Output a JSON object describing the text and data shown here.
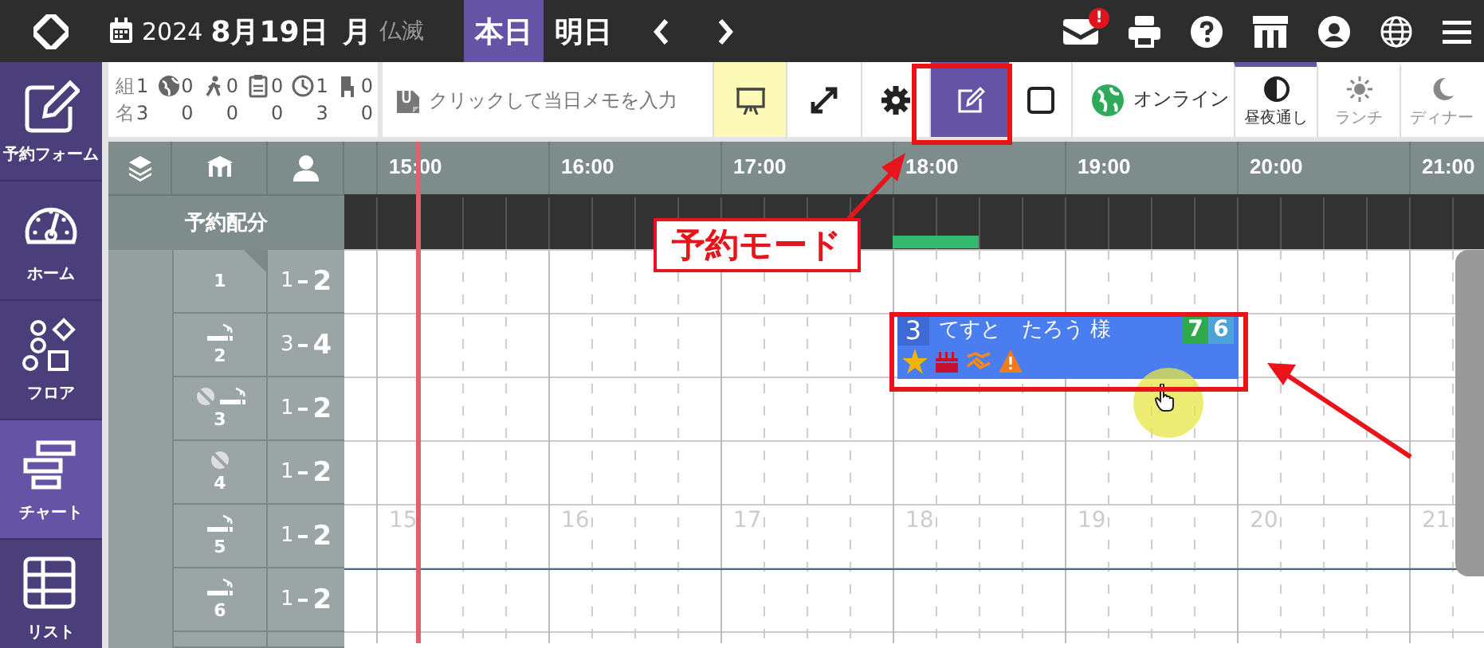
{
  "top_bar": {
    "date": {
      "year": "2024",
      "day": "8月19日",
      "weekday": "月",
      "rokuyo": "仏滅"
    },
    "day_tabs": [
      {
        "label": "本日",
        "selected": true
      },
      {
        "label": "明日",
        "selected": false
      }
    ],
    "mail_badge": "!"
  },
  "sidebar": {
    "items": [
      {
        "kind": "form",
        "label": "予約フォーム",
        "selected": false
      },
      {
        "kind": "home",
        "label": "ホーム",
        "selected": false
      },
      {
        "kind": "floor",
        "label": "フロア",
        "selected": false
      },
      {
        "kind": "chart",
        "label": "チャート",
        "selected": true
      },
      {
        "kind": "list",
        "label": "リスト",
        "selected": false
      }
    ]
  },
  "toolbar": {
    "stats": [
      {
        "label": "組",
        "values": [
          "1",
          "0",
          "0",
          "0",
          "1",
          "0"
        ]
      },
      {
        "label": "名",
        "values": [
          "3",
          "0",
          "0",
          "0",
          "3",
          "0"
        ]
      }
    ],
    "memo": {
      "placeholder": "クリックして当日メモを入力"
    },
    "tool_buttons": [
      {
        "kind": "presentation",
        "on": true
      },
      {
        "kind": "expand",
        "on": false
      },
      {
        "kind": "settings",
        "on": false
      },
      {
        "kind": "edit",
        "on": true
      },
      {
        "kind": "checkbox",
        "on": false
      }
    ],
    "online": {
      "label": "オンライン"
    },
    "meal_tabs": [
      {
        "kind": "all",
        "label": "昼夜通し",
        "selected": true
      },
      {
        "kind": "lunch",
        "label": "ランチ",
        "selected": false
      },
      {
        "kind": "dinner",
        "label": "ディナー",
        "selected": false
      }
    ]
  },
  "chart": {
    "hours": [
      "15:00",
      "16:00",
      "17:00",
      "18:00",
      "19:00",
      "20:00",
      "21:00"
    ],
    "allocation_label": "予約配分",
    "grid_hour_labels": [
      "15",
      "16",
      "17",
      "18",
      "19",
      "20",
      "21"
    ],
    "tables": [
      {
        "name": "1",
        "smoking": false,
        "blocked": false,
        "corner_mark": true,
        "min": "1",
        "max": "2"
      },
      {
        "name": "2",
        "smoking": true,
        "blocked": false,
        "corner_mark": false,
        "min": "3",
        "max": "4"
      },
      {
        "name": "3",
        "smoking": true,
        "blocked": true,
        "corner_mark": false,
        "min": "1",
        "max": "2"
      },
      {
        "name": "4",
        "smoking": false,
        "blocked": true,
        "corner_mark": false,
        "min": "1",
        "max": "2"
      },
      {
        "name": "5",
        "smoking": true,
        "blocked": false,
        "corner_mark": false,
        "min": "1",
        "max": "2"
      },
      {
        "name": "6",
        "smoking": true,
        "blocked": false,
        "corner_mark": false,
        "min": "1",
        "max": "2"
      }
    ],
    "reservation": {
      "party": "3",
      "name": "てすと　たろう 様",
      "badges": [
        {
          "text": "7",
          "color": "#2eaa4a"
        },
        {
          "text": "6",
          "color": "#4ba3d8"
        }
      ],
      "icons": [
        {
          "kind": "star"
        },
        {
          "kind": "cake"
        },
        {
          "kind": "handshake"
        },
        {
          "kind": "warning"
        }
      ]
    }
  },
  "annotation": {
    "callout": "予約モード"
  }
}
